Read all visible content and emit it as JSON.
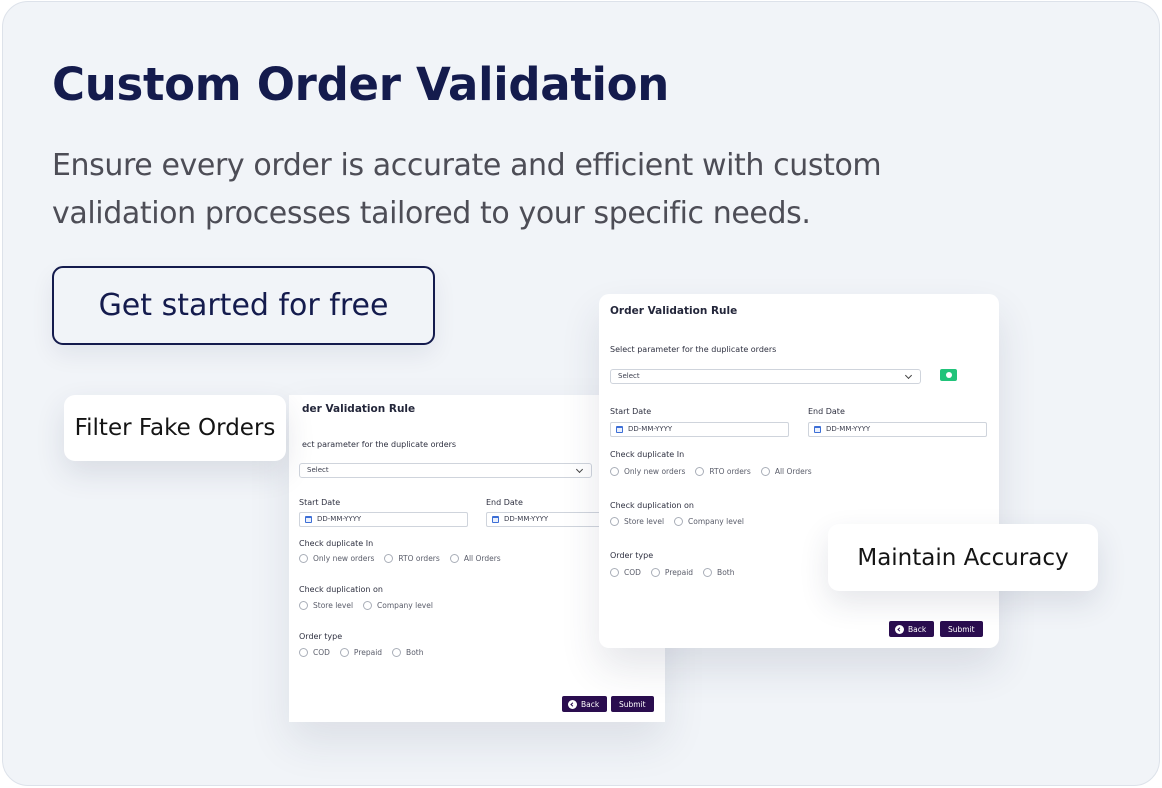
{
  "hero": {
    "title": "Custom Order Validation",
    "subtitle": "Ensure every order is accurate and efficient with custom validation processes tailored to your specific needs.",
    "cta_label": "Get started for free"
  },
  "tags": {
    "filter": "Filter Fake Orders",
    "accuracy": "Maintain Accuracy"
  },
  "form_back": {
    "title": "der Validation Rule",
    "param_label": "ect parameter for the duplicate orders",
    "select_value": "Select",
    "start_label": "Start Date",
    "end_label": "End Date",
    "start_placeholder": "DD-MM-YYYY",
    "end_placeholder": "DD-MM-YYYY",
    "check_in_label": "Check duplicate In",
    "check_in_options": [
      "Only new orders",
      "RTO orders",
      "All Orders"
    ],
    "check_on_label": "Check duplication on",
    "check_on_options": [
      "Store level",
      "Company level"
    ],
    "order_type_label": "Order type",
    "order_type_options": [
      "COD",
      "Prepaid",
      "Both"
    ],
    "back_label": "Back",
    "submit_label": "Submit"
  },
  "form_front": {
    "title": "Order Validation Rule",
    "param_label": "Select parameter for the duplicate orders",
    "select_value": "Select",
    "start_label": "Start Date",
    "end_label": "End Date",
    "start_placeholder": "DD-MM-YYYY",
    "end_placeholder": "DD-MM-YYYY",
    "check_in_label": "Check duplicate In",
    "check_in_options": [
      "Only new orders",
      "RTO orders",
      "All Orders"
    ],
    "check_on_label": "Check duplication on",
    "check_on_options": [
      "Store level",
      "Company level"
    ],
    "order_type_label": "Order type",
    "order_type_options": [
      "COD",
      "Prepaid",
      "Both"
    ],
    "back_label": "Back",
    "submit_label": "Submit"
  },
  "colors": {
    "navy": "#141b4d",
    "background": "#f1f4f8",
    "button_purple": "#2a0d4f",
    "add_green": "#21c37a",
    "calendar_blue": "#3d6fd6"
  }
}
